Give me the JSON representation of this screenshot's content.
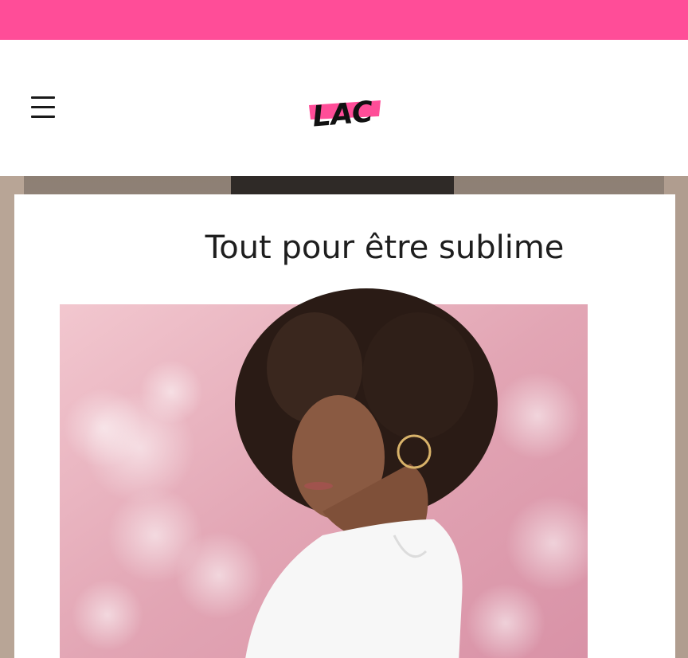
{
  "colors": {
    "accent": "#ff4d98"
  },
  "header": {
    "menu_icon": "hamburger-menu-icon",
    "logo_text": "LAC"
  },
  "hero": {
    "title": "Tout pour être sublime"
  }
}
